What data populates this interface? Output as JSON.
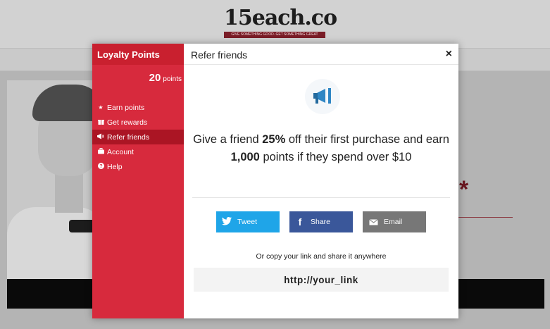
{
  "logo": {
    "main": "15each.co",
    "tagline": "GIVE SOMETHING GOOD. GET SOMETHING GREAT"
  },
  "sidebar": {
    "title": "Loyalty Points",
    "points_value": "20",
    "points_unit": "points",
    "items": [
      {
        "label": "Earn points",
        "icon": "star-icon"
      },
      {
        "label": "Get rewards",
        "icon": "gift-icon"
      },
      {
        "label": "Refer friends",
        "icon": "megaphone-icon"
      },
      {
        "label": "Account",
        "icon": "briefcase-icon"
      },
      {
        "label": "Help",
        "icon": "question-circle-icon"
      }
    ],
    "active_index": 2
  },
  "panel": {
    "title": "Refer friends",
    "close": "×",
    "offer": {
      "part1": "Give a friend ",
      "discount": "25%",
      "part2": " off their first purchase and earn ",
      "points": "1,000",
      "part3": " points if they spend over $10"
    },
    "buttons": {
      "tweet": "Tweet",
      "share": "Share",
      "email": "Email"
    },
    "copy_text": "Or copy your link and share it anywhere",
    "link": "http://your_link"
  },
  "colors": {
    "sidebar": "#d72a3d",
    "sidebar_active": "#ab1524",
    "twitter": "#1fa5e8",
    "facebook": "#3a579a",
    "email": "#777777",
    "icon_blue": "#2f86c4"
  }
}
